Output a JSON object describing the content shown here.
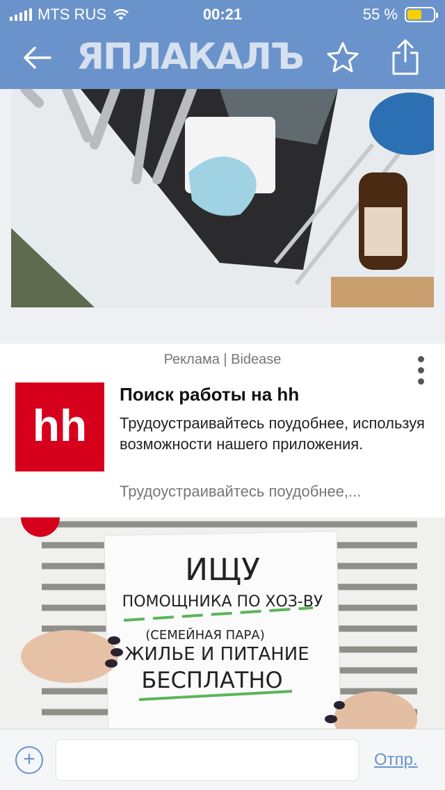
{
  "status_bar": {
    "carrier": "MTS RUS",
    "time": "00:21",
    "battery": "55 %",
    "battery_level": 0.55
  },
  "header": {
    "logo_text": "ЯПЛАКАЛЪ",
    "back_icon": "arrow-left-icon",
    "favorite_icon": "star-icon",
    "share_icon": "share-icon"
  },
  "ad": {
    "sponsor": "Реклама | Bidease",
    "logo_text": "hh",
    "title": "Поиск работы на hh",
    "description": "Трудоустраивайтесь поудобнее, используя возможности нашего приложения.",
    "description_short": "Трудоустраивайтесь поудобнее,...",
    "sign_lines": [
      "ИЩУ",
      "ПОМОЩНИКА ПО ХОЗ-ВУ",
      "(СЕМЕЙНАЯ ПАРА)",
      "ЖИЛЬЕ И ПИТАНИЕ",
      "БЕСПЛАТНО"
    ]
  },
  "comment_bar": {
    "input_value": "",
    "send_label": "Отпр."
  },
  "colors": {
    "header": "#6a93cb",
    "hh_brand": "#d6001c",
    "accent": "#6a93cb"
  }
}
